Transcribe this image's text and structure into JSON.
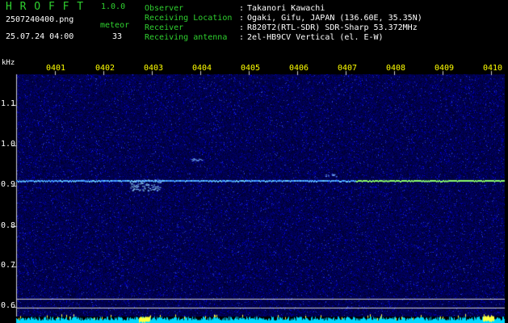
{
  "app": {
    "title": "H R O F F T",
    "version": "1.0.0"
  },
  "file": {
    "name": "2507240400.png",
    "datetime": "25.07.24 04:00",
    "meteor_label": "meteor",
    "meteor_count": "33"
  },
  "info": [
    {
      "label": "Observer",
      "sep": ":",
      "value": "Takanori Kawachi"
    },
    {
      "label": "Receiving Location",
      "sep": ":",
      "value": "Ogaki, Gifu, JAPAN (136.60E, 35.35N)"
    },
    {
      "label": "Receiver",
      "sep": ":",
      "value": "R820T2(RTL-SDR) SDR-Sharp 53.372MHz"
    },
    {
      "label": "Receiving antenna",
      "sep": ":",
      "value": "2el-HB9CV Vertical (el. E-W)"
    }
  ],
  "axis": {
    "unit": "kHz",
    "y_ticks": [
      "1.1",
      "1.0",
      "0.9",
      "0.8",
      "0.7",
      "0.6"
    ],
    "x_ticks": [
      "0401",
      "0402",
      "0403",
      "0404",
      "0405",
      "0406",
      "0407",
      "0408",
      "0409",
      "0410"
    ]
  },
  "colors": {
    "background": "#000000",
    "header_text": "#2fd02f",
    "time_labels": "#ffff00",
    "axis_text": "#ffffff",
    "spectrum_base": "#00008c",
    "signal_line": "#7aff7a",
    "amplitude_bar": "#00e5ff"
  }
}
